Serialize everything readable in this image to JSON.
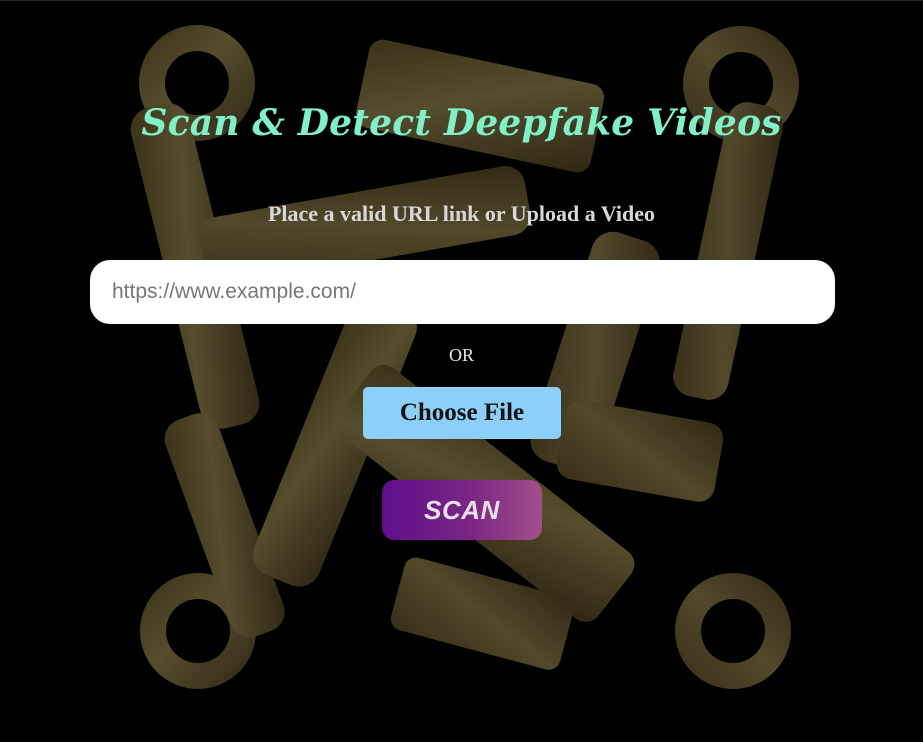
{
  "page": {
    "title": "Scan & Detect Deepfake Videos",
    "subtitle": "Place a valid URL link or Upload a Video",
    "url_input": {
      "placeholder": "https://www.example.com/",
      "value": ""
    },
    "or_label": "OR",
    "choose_file_label": "Choose File",
    "scan_label": "SCAN"
  },
  "background": {
    "icon": "gold-interlocking-keys-logo",
    "color_light": "#8a7d48",
    "color_dark": "#4b3e1f"
  },
  "colors": {
    "title": "#7ff0c8",
    "choose_file_bg": "#8ccff8",
    "scan_gradient_start": "#5c0f8a",
    "scan_gradient_end": "#a14f8a"
  }
}
